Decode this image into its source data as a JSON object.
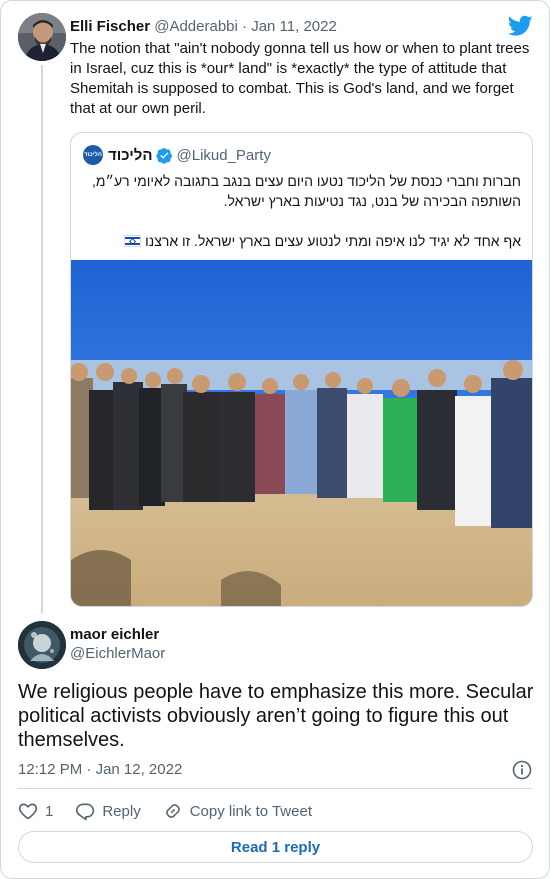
{
  "parent_tweet": {
    "author_name": "Elli Fischer",
    "author_handle": "@Adderabbi",
    "separator": "·",
    "date": "Jan 11, 2022",
    "text": "The notion that \"ain't nobody gonna tell us how or when to plant trees in Israel, cuz this is *our* land\" is *exactly* the type of attitude that Shemitah is supposed to combat. This is God's land, and we forget that at our own peril."
  },
  "quoted_tweet": {
    "avatar_text": "הליכוד",
    "author_name": "הליכוד",
    "author_handle": "@Likud_Party",
    "text_line1": "חברות וחברי כנסת של הליכוד נטעו היום עצים בנגב בתגובה לאיומי רע״מ, השותפה הבכירה של בנט, נגד נטיעות בארץ ישראל.",
    "text_line2": "אף אחד לא יגיד לנו איפה ומתי לנטוע עצים בארץ ישראל. זו ארצנו"
  },
  "reply_tweet": {
    "author_name": "maor eichler",
    "author_handle": "@EichlerMaor",
    "text": "We religious people have to emphasize this more. Secular political activists obviously aren’t going to figure this out themselves.",
    "time": "12:12 PM",
    "separator": "·",
    "date": "Jan 12, 2022"
  },
  "actions": {
    "like_count": "1",
    "reply_label": "Reply",
    "copy_link_label": "Copy link to Tweet"
  },
  "read_replies_label": "Read 1 reply",
  "colors": {
    "twitter_blue": "#1d9bf0",
    "like_red": "#e0245e",
    "text_muted": "#536471",
    "border": "#cfd9de"
  }
}
